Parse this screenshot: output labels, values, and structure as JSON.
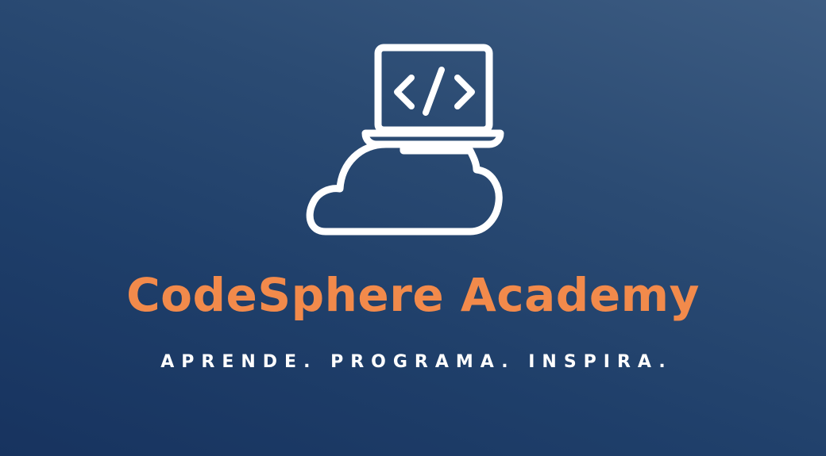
{
  "brand": {
    "name": "CodeSphere Academy",
    "tagline": "APRENDE. PROGRAMA. INSPIRA.",
    "logo_icon": "laptop-cloud-code-icon"
  },
  "colors": {
    "background_dark": "#17335f",
    "background_light": "#3d5c82",
    "accent": "#f28a4b",
    "icon": "#ffffff",
    "tagline": "#ffffff"
  }
}
